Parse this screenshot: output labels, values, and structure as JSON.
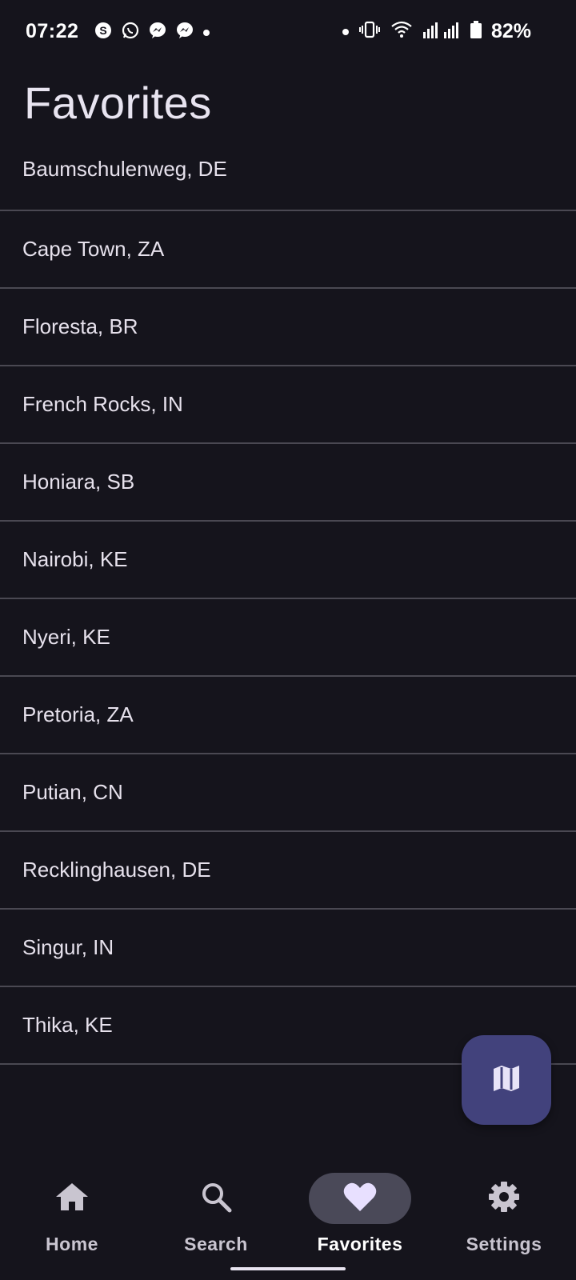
{
  "status_bar": {
    "time": "07:22",
    "battery": "82%",
    "left_icons": [
      "skype-icon",
      "whatsapp-icon",
      "messenger-icon",
      "messenger-icon",
      "dot-icon"
    ],
    "right_icons": [
      "dot-icon",
      "vibrate-icon",
      "wifi-icon",
      "signal-icon",
      "signal-icon",
      "battery-icon"
    ]
  },
  "header": {
    "title": "Favorites"
  },
  "favorites": [
    "Baumschulenweg, DE",
    "Cape Town, ZA",
    "Floresta, BR",
    "French Rocks, IN",
    "Honiara, SB",
    "Nairobi, KE",
    "Nyeri, KE",
    "Pretoria, ZA",
    "Putian, CN",
    "Recklinghausen, DE",
    "Singur, IN",
    "Thika, KE"
  ],
  "fab": {
    "icon": "map-icon"
  },
  "bottom_nav": {
    "items": [
      {
        "label": "Home",
        "icon": "home-icon",
        "active": false
      },
      {
        "label": "Search",
        "icon": "search-icon",
        "active": false
      },
      {
        "label": "Favorites",
        "icon": "heart-icon",
        "active": true
      },
      {
        "label": "Settings",
        "icon": "gear-icon",
        "active": false
      }
    ]
  },
  "colors": {
    "background": "#15141c",
    "divider": "#4a4852",
    "fab": "#42427c",
    "nav_active_pill": "#4a4958",
    "text": "#e6e1ec"
  }
}
